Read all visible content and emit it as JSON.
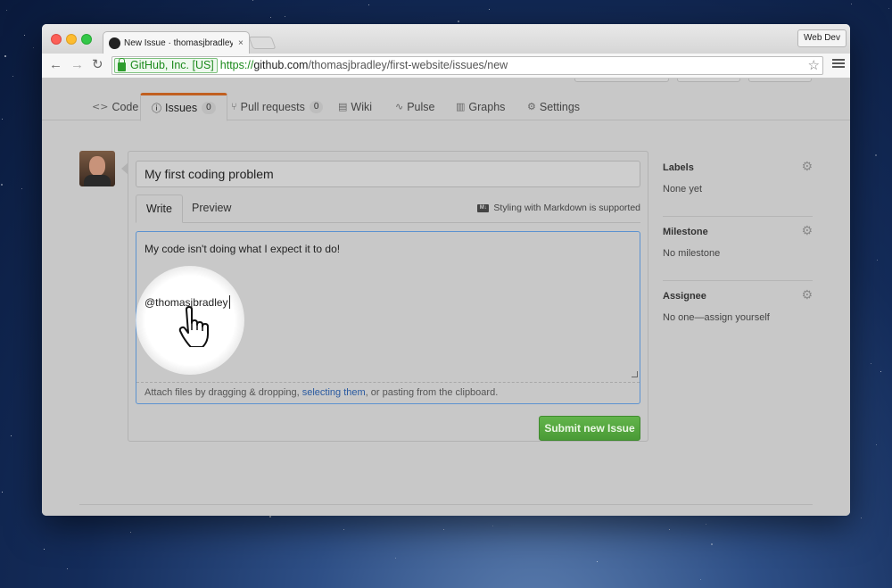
{
  "browser": {
    "tab_title": "New Issue · thomasjbradley",
    "tab_close": "×",
    "profile": "Web Dev",
    "back": "←",
    "forward": "→",
    "reload": "↻",
    "secure_label": "GitHub, Inc. [US]",
    "url_scheme": "https://",
    "url_host": "github.com",
    "url_path": "/thomasjbradley/first-website/issues/new",
    "bookmark_star": "☆"
  },
  "repo_nav": {
    "tabs": [
      {
        "icon": "<>",
        "label": "Code"
      },
      {
        "icon": "ⓘ",
        "label": "Issues",
        "count": "0"
      },
      {
        "icon": "⑂",
        "label": "Pull requests",
        "count": "0"
      },
      {
        "icon": "▤",
        "label": "Wiki"
      },
      {
        "icon": "∿",
        "label": "Pulse"
      },
      {
        "icon": "▥",
        "label": "Graphs"
      },
      {
        "icon": "⚙",
        "label": "Settings"
      }
    ]
  },
  "issue_form": {
    "title_value": "My first coding problem",
    "write_tab": "Write",
    "preview_tab": "Preview",
    "markdown_icon": "M↓",
    "markdown_note": "Styling with Markdown is supported",
    "body_line1": "My code isn't doing what I expect it to do!",
    "body_line2": "@thomasjbradley",
    "attach_prefix": "Attach files by dragging & dropping, ",
    "attach_link": "selecting them",
    "attach_suffix": ", or pasting from the clipboard.",
    "submit_label": "Submit new Issue"
  },
  "sidebar": {
    "sections": [
      {
        "label": "Labels",
        "value": "None yet",
        "icon": "gear-icon"
      },
      {
        "label": "Milestone",
        "value": "No milestone",
        "icon": "gear-icon"
      },
      {
        "label": "Assignee",
        "value": "No one—assign yourself",
        "icon": "gear-icon"
      }
    ]
  },
  "colors": {
    "selected_tab_accent": "#c16020",
    "submit_green": "#4a9b36",
    "focus_blue": "#5b92d0",
    "link_blue": "#2a5aa0"
  }
}
